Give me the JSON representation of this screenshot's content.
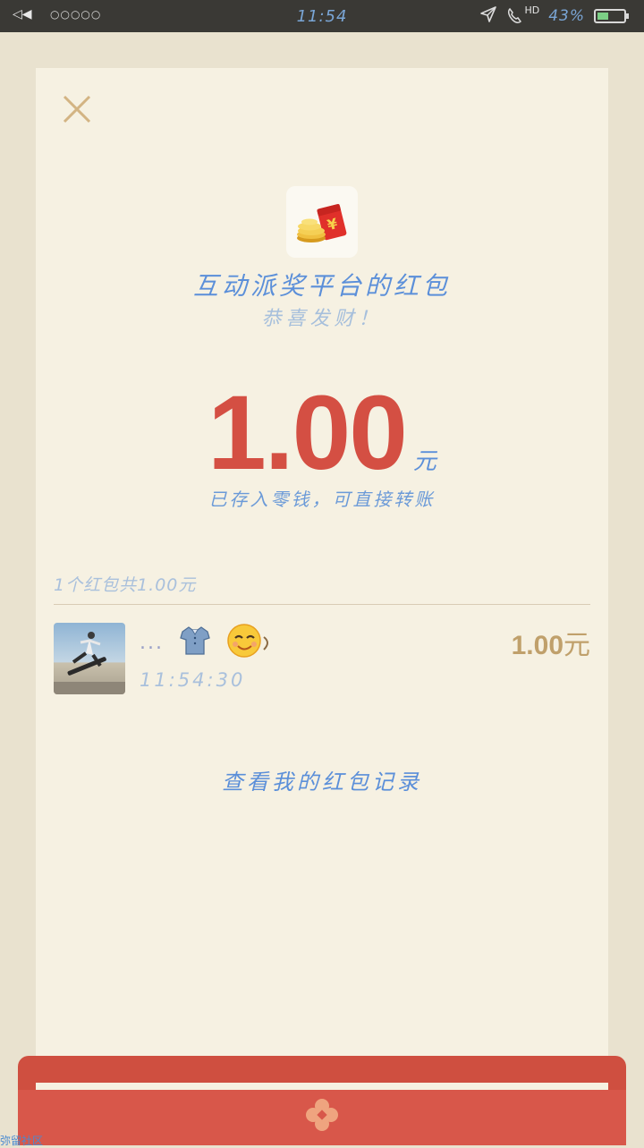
{
  "status_bar": {
    "left_icons": "◁◀",
    "dots": "○○○○○",
    "time": "11:54",
    "hd_label": "HD",
    "battery_percent": "43%",
    "battery_level": 0.43,
    "icons": [
      "back-icon",
      "signal-dots-icon",
      "send-icon",
      "call-hd-icon",
      "battery-icon"
    ]
  },
  "card": {
    "close_icon": "close-icon",
    "logo_icon": "red-envelope-coins-icon",
    "title": "互动派奖平台的红包",
    "subtitle": "恭喜发财！",
    "amount": "1.00",
    "amount_unit": "元",
    "saved_note": "已存入零钱，可直接转账",
    "summary": "1个红包共1.00元",
    "receivers": [
      {
        "name_prefix": "...",
        "emoji_shirt": "👕",
        "emoji_face": "😊",
        "time": "11:54:30",
        "amount": "1.00",
        "amount_unit": "元"
      }
    ],
    "records_link": "查看我的红包记录"
  },
  "footer": {
    "watermark": "弥留社区"
  },
  "colors": {
    "background": "#e9e2cf",
    "card": "#f6f1e2",
    "amount_red": "#d44f43",
    "text_blue": "#5b8fd9",
    "gold": "#c0a06b",
    "envelope_red": "#d8574a"
  }
}
